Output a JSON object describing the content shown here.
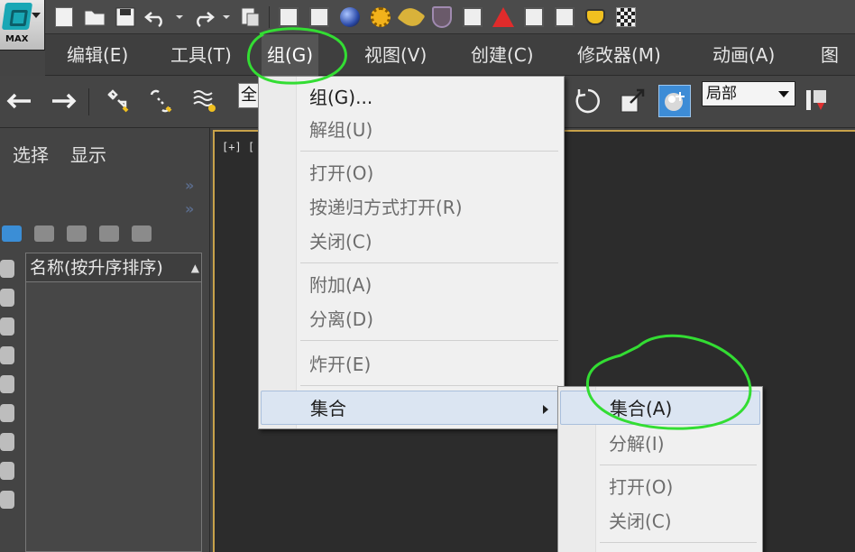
{
  "app": {
    "logo_label": "MAX"
  },
  "menubar": {
    "items": [
      {
        "label": "编辑(E)"
      },
      {
        "label": "工具(T)"
      },
      {
        "label": "组(G)"
      },
      {
        "label": "视图(V)"
      },
      {
        "label": "创建(C)"
      },
      {
        "label": "修改器(M)"
      },
      {
        "label": "动画(A)"
      },
      {
        "label": "图形"
      }
    ]
  },
  "toolbar": {
    "selection_filter_value": "全",
    "coord_system_value": "局部"
  },
  "command_panel": {
    "tabs": [
      {
        "label": "选择"
      },
      {
        "label": "显示"
      }
    ],
    "list_header": "名称(按升序排序)"
  },
  "viewport": {
    "label": "[+] ["
  },
  "group_menu": {
    "items": [
      {
        "label": "组(G)...",
        "enabled": true
      },
      {
        "label": "解组(U)",
        "enabled": false
      },
      {
        "label": "打开(O)",
        "enabled": false
      },
      {
        "label": "按递归方式打开(R)",
        "enabled": false
      },
      {
        "label": "关闭(C)",
        "enabled": false
      },
      {
        "label": "附加(A)",
        "enabled": false
      },
      {
        "label": "分离(D)",
        "enabled": false
      },
      {
        "label": "炸开(E)",
        "enabled": false
      },
      {
        "label": "集合",
        "enabled": true,
        "has_submenu": true
      }
    ]
  },
  "assembly_submenu": {
    "items": [
      {
        "label": "集合(A)",
        "enabled": true
      },
      {
        "label": "分解(I)",
        "enabled": false
      },
      {
        "label": "打开(O)",
        "enabled": false
      },
      {
        "label": "关闭(C)",
        "enabled": false
      }
    ]
  },
  "colors": {
    "annotation": "#33dd33",
    "viewport_border": "#c8a24a",
    "menu_highlight": "#dbe5f2"
  }
}
